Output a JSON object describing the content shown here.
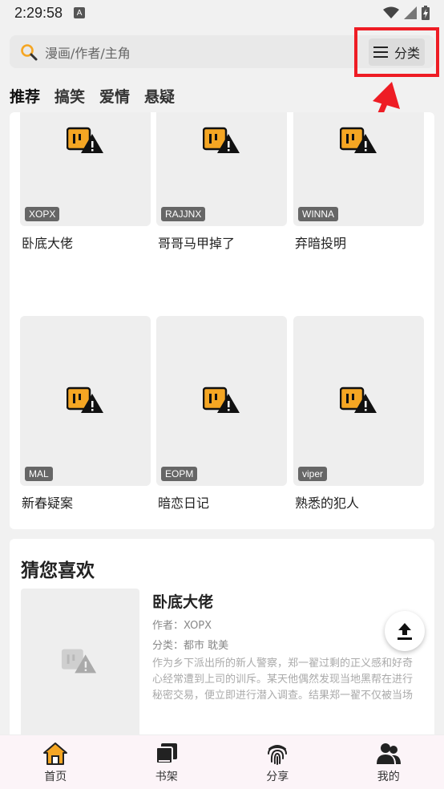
{
  "status": {
    "time": "2:29:58",
    "notif": "A"
  },
  "search": {
    "placeholder": "漫画/作者/主角",
    "category_label": "分类"
  },
  "tabs": [
    {
      "label": "推荐",
      "active": true
    },
    {
      "label": "搞笑",
      "active": false
    },
    {
      "label": "爱情",
      "active": false
    },
    {
      "label": "悬疑",
      "active": false
    }
  ],
  "grid": [
    {
      "badge": "XOPX",
      "title": "卧底大佬"
    },
    {
      "badge": "RAJJNX",
      "title": "哥哥马甲掉了"
    },
    {
      "badge": "WINNA",
      "title": "弃暗投明"
    },
    {
      "badge": "MAL",
      "title": "新春疑案"
    },
    {
      "badge": "EOPM",
      "title": "暗恋日记"
    },
    {
      "badge": "viper",
      "title": "熟悉的犯人"
    }
  ],
  "recommend": {
    "section_title": "猜您喜欢",
    "name": "卧底大佬",
    "author": "作者：XOPX",
    "category": "分类：都市 耽美",
    "description": "作为乡下派出所的新人警察，郑一翟过剩的正义感和好奇心经常遭到上司的训斥。某天他偶然发现当地黑帮在进行秘密交易，便立即进行潜入调查。结果郑一翟不仅被当场抓住，还发现对方的老大是自己曾经的同学-车…"
  },
  "bottom_nav": [
    {
      "label": "首页",
      "icon": "home-icon"
    },
    {
      "label": "书架",
      "icon": "bookshelf-icon"
    },
    {
      "label": "分享",
      "icon": "fingerprint-icon"
    },
    {
      "label": "我的",
      "icon": "user-group-icon"
    }
  ],
  "colors": {
    "accent": "#f5a623",
    "highlight": "#ee1c24",
    "nav_bg": "#fcf4f8"
  }
}
